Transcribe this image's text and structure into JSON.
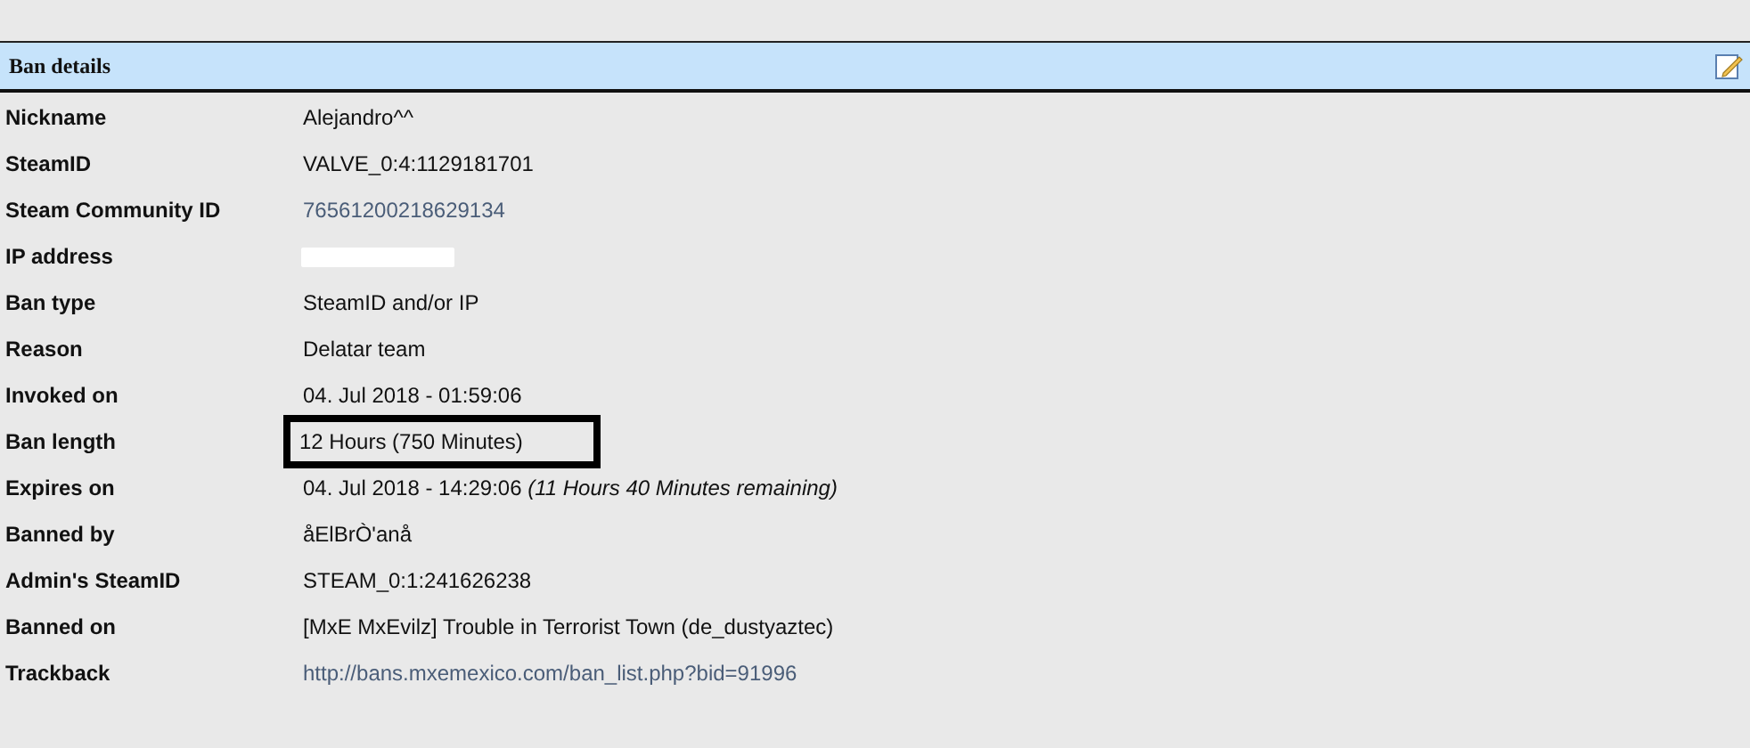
{
  "panel": {
    "title": "Ban details"
  },
  "rows": [
    {
      "label": "Nickname",
      "kind": "text",
      "value": "Alejandro^^"
    },
    {
      "label": "SteamID",
      "kind": "text",
      "value": "VALVE_0:4:1129181701"
    },
    {
      "label": "Steam Community ID",
      "kind": "link",
      "value": "76561200218629134"
    },
    {
      "label": "IP address",
      "kind": "redacted"
    },
    {
      "label": "Ban type",
      "kind": "text",
      "value": "SteamID and/or IP"
    },
    {
      "label": "Reason",
      "kind": "text",
      "value": "Delatar team"
    },
    {
      "label": "Invoked on",
      "kind": "text",
      "value": "04. Jul 2018 - 01:59:06"
    },
    {
      "label": "Ban length",
      "kind": "text",
      "value": "12 Hours  (750 Minutes)",
      "highlighted": true
    },
    {
      "label": "Expires on",
      "kind": "text",
      "value": "04. Jul 2018 - 14:29:06 *(11 Hours 40 Minutes remaining)*"
    },
    {
      "label": "Banned by",
      "kind": "text",
      "value": "åElBrÒ'anå"
    },
    {
      "label": "Admin's SteamID",
      "kind": "text",
      "value": "STEAM_0:1:241626238"
    },
    {
      "label": "Banned on",
      "kind": "text",
      "value": "[MxE MxEvilz] Trouble in Terrorist Town (de_dustyaztec)"
    },
    {
      "label": "Trackback",
      "kind": "link",
      "value": "http://bans.mxemexico.com/ban_list.php?bid=91996"
    }
  ]
}
